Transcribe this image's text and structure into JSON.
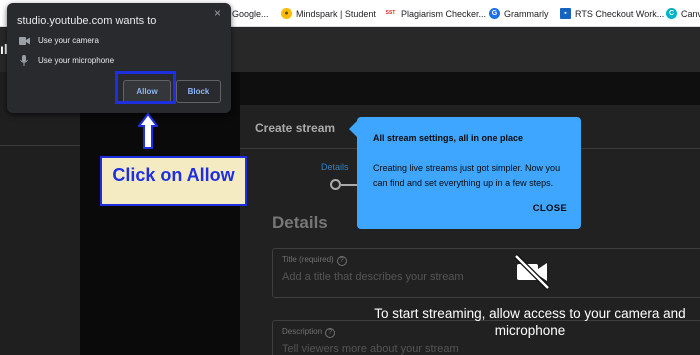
{
  "bookmarks": [
    {
      "label": "Google...",
      "icon": "google-icon"
    },
    {
      "label": "Mindspark | Student",
      "icon": "bulb-icon"
    },
    {
      "label": "Plagiarism Checker...",
      "icon": "sst-icon",
      "icon_text": "SST"
    },
    {
      "label": "Grammarly",
      "icon": "grammarly-icon"
    },
    {
      "label": "RTS Checkout Work...",
      "icon": "rts-icon"
    },
    {
      "label": "Canv",
      "icon": "canva-icon"
    }
  ],
  "app_header": {
    "partial_letter": "ıl"
  },
  "permission_popup": {
    "title": "studio.youtube.com wants to",
    "items": [
      "Use your camera",
      "Use your microphone"
    ],
    "allow_label": "Allow",
    "block_label": "Block",
    "close_symbol": "×"
  },
  "annotation": {
    "label": "Click on Allow",
    "color": "#1e2fe0",
    "box_color": "#f5ebc3"
  },
  "create_stream": {
    "title": "Create stream",
    "step_label": "Details",
    "section_heading": "Details",
    "title_field_label": "Title (required)",
    "title_field_placeholder": "Add a title that describes your stream",
    "description_field_label": "Description",
    "description_field_placeholder": "Tell viewers more about your stream"
  },
  "tooltip": {
    "title": "All stream settings, all in one place",
    "body": "Creating live streams just got simpler. Now you can find and set everything up in a few steps.",
    "close_label": "CLOSE",
    "color": "#3ea6ff"
  },
  "camera_message": "To start streaming, allow access to your camera and microphone"
}
